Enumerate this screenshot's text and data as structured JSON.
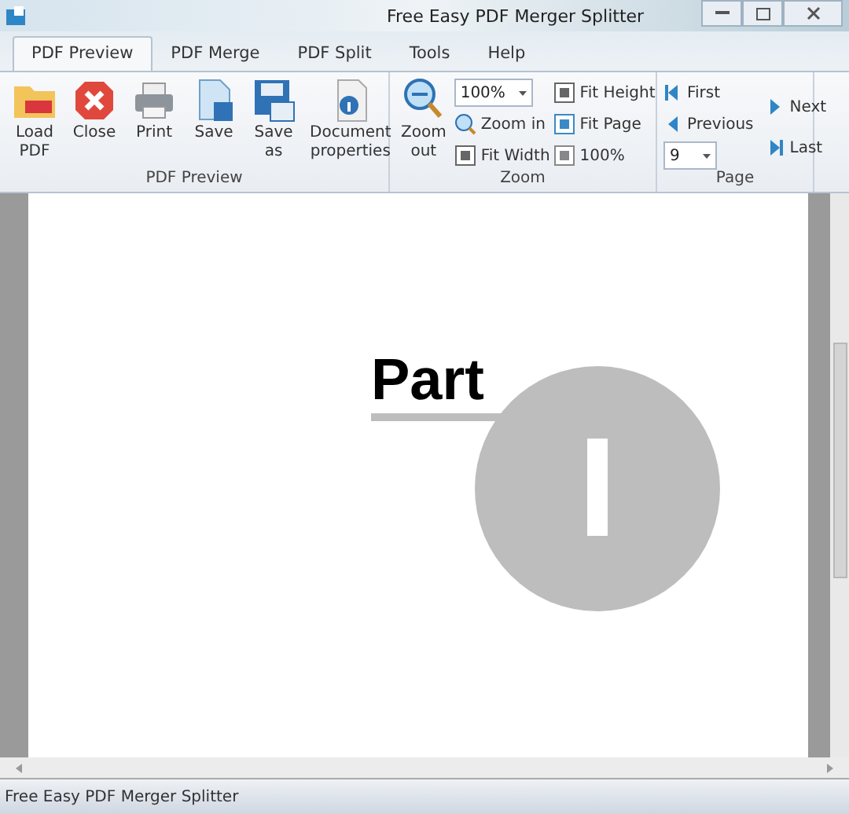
{
  "window": {
    "title": "Free Easy PDF Merger Splitter"
  },
  "tabs": [
    {
      "label": "PDF Preview",
      "selected": true
    },
    {
      "label": "PDF Merge",
      "selected": false
    },
    {
      "label": "PDF Split",
      "selected": false
    },
    {
      "label": "Tools",
      "selected": false
    },
    {
      "label": "Help",
      "selected": false
    }
  ],
  "groups": [
    {
      "label": "PDF Preview",
      "buttons": [
        {
          "label": "Load PDF"
        },
        {
          "label": "Close"
        },
        {
          "label": "Print"
        },
        {
          "label": "Save"
        },
        {
          "label": "Save as"
        },
        {
          "label": "Document properties"
        }
      ]
    },
    {
      "label": "Zoom",
      "zoom_out": "Zoom out",
      "zoom_value": "100%",
      "zoom_in": "Zoom in",
      "fit_width": "Fit Width",
      "fit_height": "Fit Height",
      "fit_page": "Fit Page",
      "actual": "100%"
    },
    {
      "label": "Page",
      "first": "First",
      "previous": "Previous",
      "page_value": "9",
      "next": "Next",
      "last": "Last"
    }
  ],
  "document": {
    "heading": "Part",
    "numeral": "I"
  },
  "status_bar": "Free Easy PDF Merger Splitter"
}
